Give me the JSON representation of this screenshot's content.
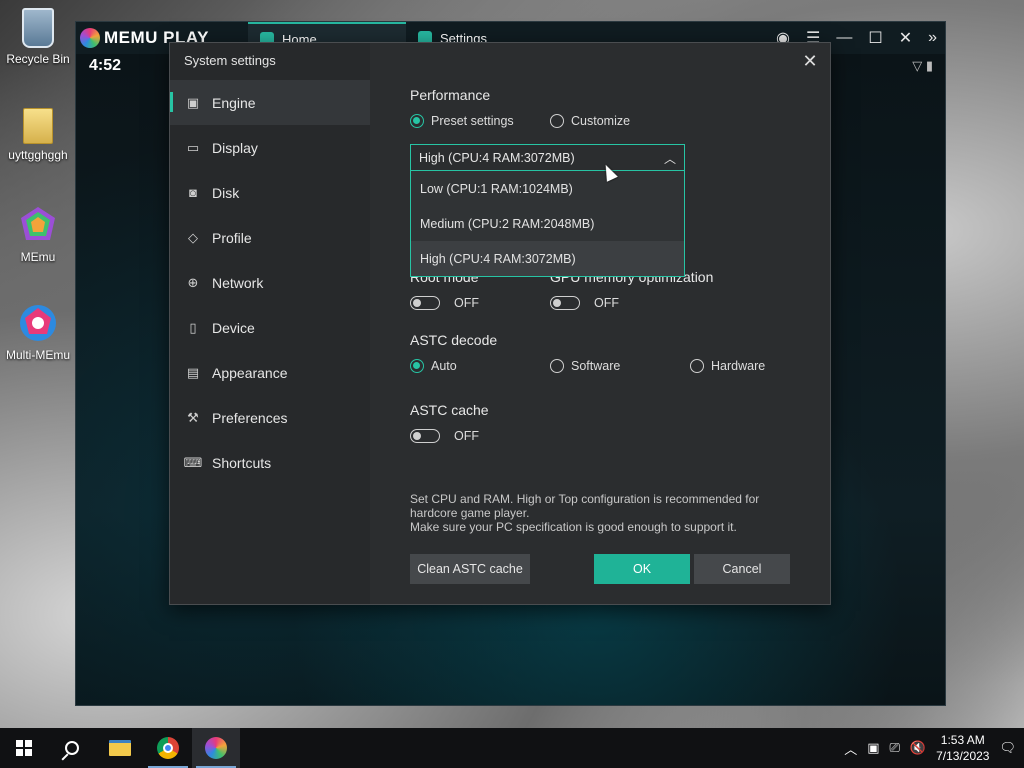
{
  "desktop": {
    "icons": [
      {
        "label": "Recycle Bin",
        "icon": "recycle-bin-icon"
      },
      {
        "label": "uyttgghggh",
        "icon": "folder-icon"
      },
      {
        "label": "MEmu",
        "icon": "memu-icon"
      },
      {
        "label": "Multi-MEmu",
        "icon": "multi-memu-icon"
      }
    ]
  },
  "emulator": {
    "brand": "MEMU PLAY",
    "tabs": [
      {
        "label": "Home",
        "icon": "home-icon"
      },
      {
        "label": "Settings",
        "icon": "settings-gear-icon"
      }
    ],
    "android_time": "4:52",
    "accent": "#27c4a4"
  },
  "dialog": {
    "title": "System settings",
    "close_glyph": "✕",
    "nav": [
      {
        "label": "Engine",
        "icon": "cpu-icon",
        "active": true
      },
      {
        "label": "Display",
        "icon": "monitor-icon"
      },
      {
        "label": "Disk",
        "icon": "disk-icon"
      },
      {
        "label": "Profile",
        "icon": "tag-icon"
      },
      {
        "label": "Network",
        "icon": "globe-icon"
      },
      {
        "label": "Device",
        "icon": "phone-icon"
      },
      {
        "label": "Appearance",
        "icon": "window-icon"
      },
      {
        "label": "Preferences",
        "icon": "wrench-icon"
      },
      {
        "label": "Shortcuts",
        "icon": "keyboard-icon"
      }
    ],
    "performance": {
      "heading": "Performance",
      "preset_label": "Preset settings",
      "customize_label": "Customize",
      "selected": "Preset settings",
      "select_value": "High (CPU:4 RAM:3072MB)",
      "options": [
        "Low (CPU:1 RAM:1024MB)",
        "Medium (CPU:2 RAM:2048MB)",
        "High (CPU:4 RAM:3072MB)"
      ]
    },
    "root_mode": {
      "heading": "Root mode",
      "state": "OFF"
    },
    "gpu_opt": {
      "heading": "GPU memory optimization",
      "state": "OFF"
    },
    "astc_decode": {
      "heading": "ASTC decode",
      "options": [
        "Auto",
        "Software",
        "Hardware"
      ],
      "selected": "Auto"
    },
    "astc_cache": {
      "heading": "ASTC cache",
      "state": "OFF"
    },
    "hint_line1": "Set CPU and RAM. High or Top configuration is recommended for hardcore game player.",
    "hint_line2": "Make sure your PC specification is good enough to support it.",
    "buttons": {
      "clean": "Clean ASTC cache",
      "ok": "OK",
      "cancel": "Cancel"
    }
  },
  "taskbar": {
    "time": "1:53 AM",
    "date": "7/13/2023"
  }
}
